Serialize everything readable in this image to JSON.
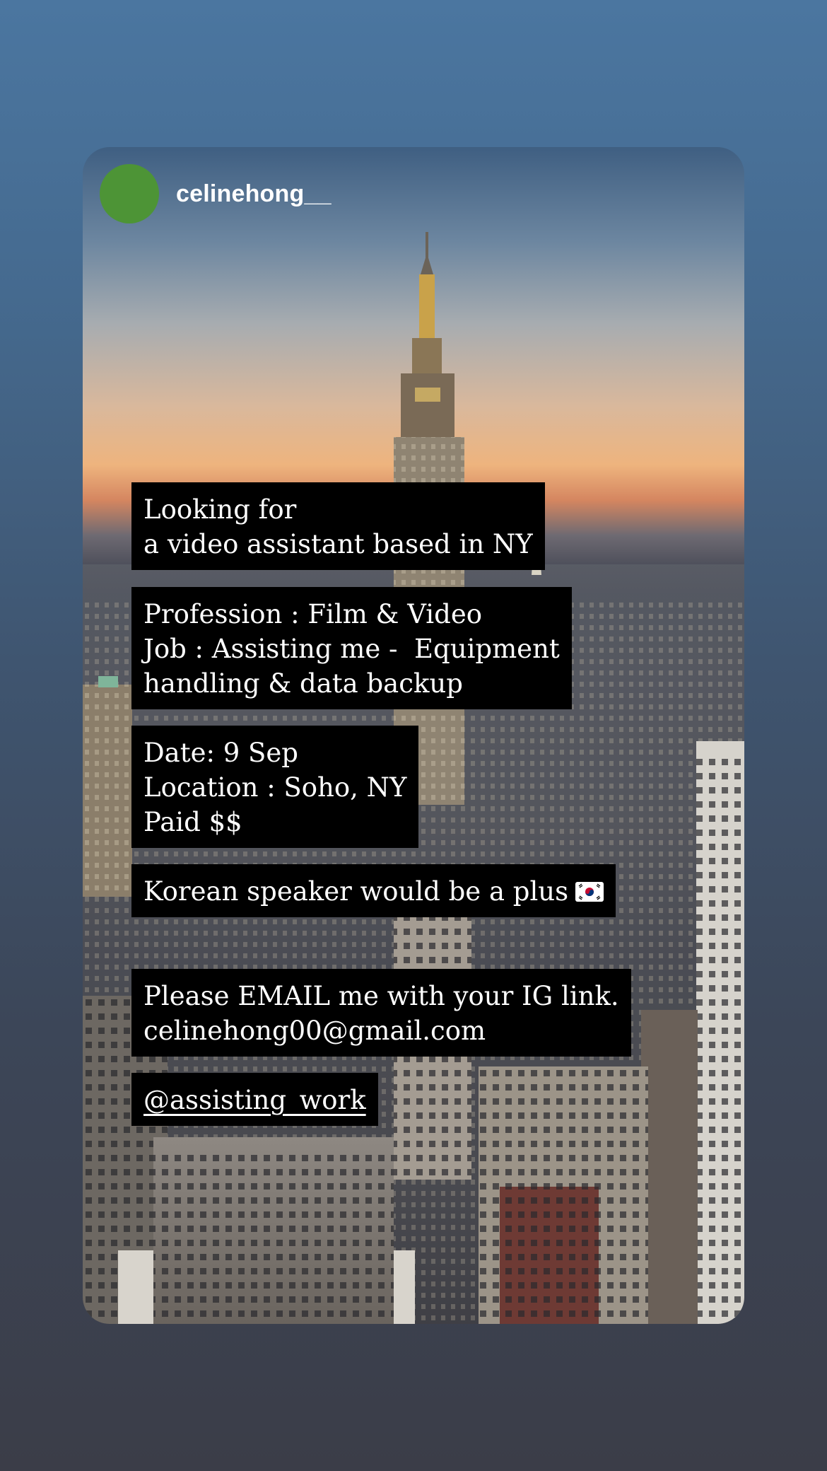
{
  "story": {
    "username": "celinehong__",
    "avatar_color": "#4d9436",
    "text_blocks": {
      "headline_line1": "Looking for",
      "headline_line2": "a video assistant based in NY",
      "details_line1": "Profession : Film & Video",
      "details_line2": "Job : Assisting me -  Equipment",
      "details_line3": "handling & data backup",
      "info_line1": "Date: 9 Sep",
      "info_line2": "Location : Soho, NY",
      "info_line3": "Paid $$",
      "language_note": "Korean speaker would be a plus",
      "contact_line1": "Please EMAIL me with your IG link.",
      "contact_line2": "celinehong00@gmail.com",
      "mention": "@assisting_work"
    },
    "flag_icon": "south-korea-flag-icon",
    "background_image": "new-york-skyline-at-sunset"
  }
}
